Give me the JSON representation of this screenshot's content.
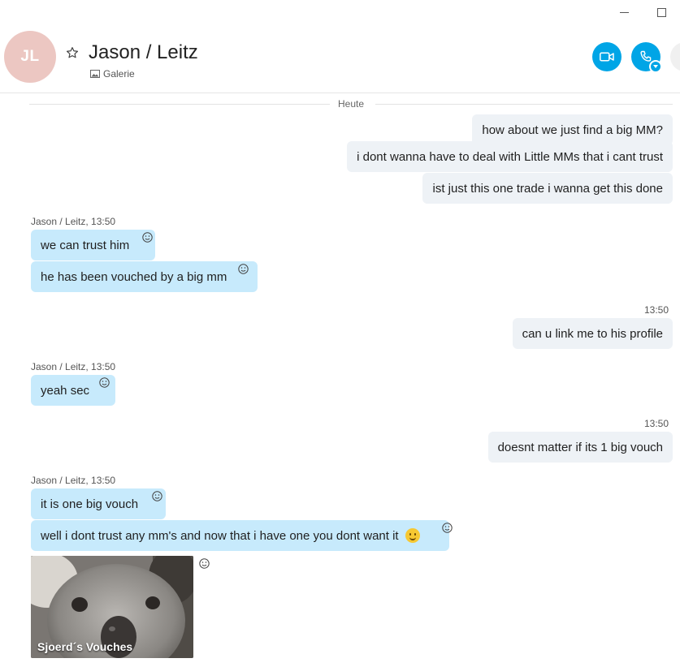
{
  "window": {
    "minimize_icon": "minimize-icon",
    "maximize_icon": "maximize-icon"
  },
  "header": {
    "avatar_initials": "JL",
    "avatar_color": "#ecc7c2",
    "title": "Jason / Leitz",
    "gallery_label": "Galerie",
    "accent_color": "#00a5e6"
  },
  "chat": {
    "date_divider": "Heute",
    "messages": [
      {
        "direction": "out",
        "text": "how about we just find a big MM?"
      },
      {
        "direction": "out",
        "text": "i dont wanna have to deal with Little MMs that i cant trust"
      },
      {
        "direction": "out",
        "text": "ist just this one trade i wanna get this done"
      },
      {
        "direction": "in",
        "sender": "Jason / Leitz, 13:50",
        "text": "we can trust him"
      },
      {
        "direction": "in",
        "text": "he has been vouched by a big mm"
      },
      {
        "direction": "out",
        "time": "13:50",
        "text": "can u link me to his profile"
      },
      {
        "direction": "in",
        "sender": "Jason / Leitz, 13:50",
        "text": "yeah sec"
      },
      {
        "direction": "out",
        "time": "13:50",
        "text": "doesnt matter if its 1 big vouch"
      },
      {
        "direction": "in",
        "sender": "Jason / Leitz, 13:50",
        "text": "it is one big vouch"
      },
      {
        "direction": "in",
        "text": "well i dont trust any mm's and now that i have one you dont want it",
        "emoji": "smile-emoji"
      },
      {
        "direction": "in",
        "type": "image",
        "caption": "Sjoerd´s Vouches"
      }
    ]
  }
}
